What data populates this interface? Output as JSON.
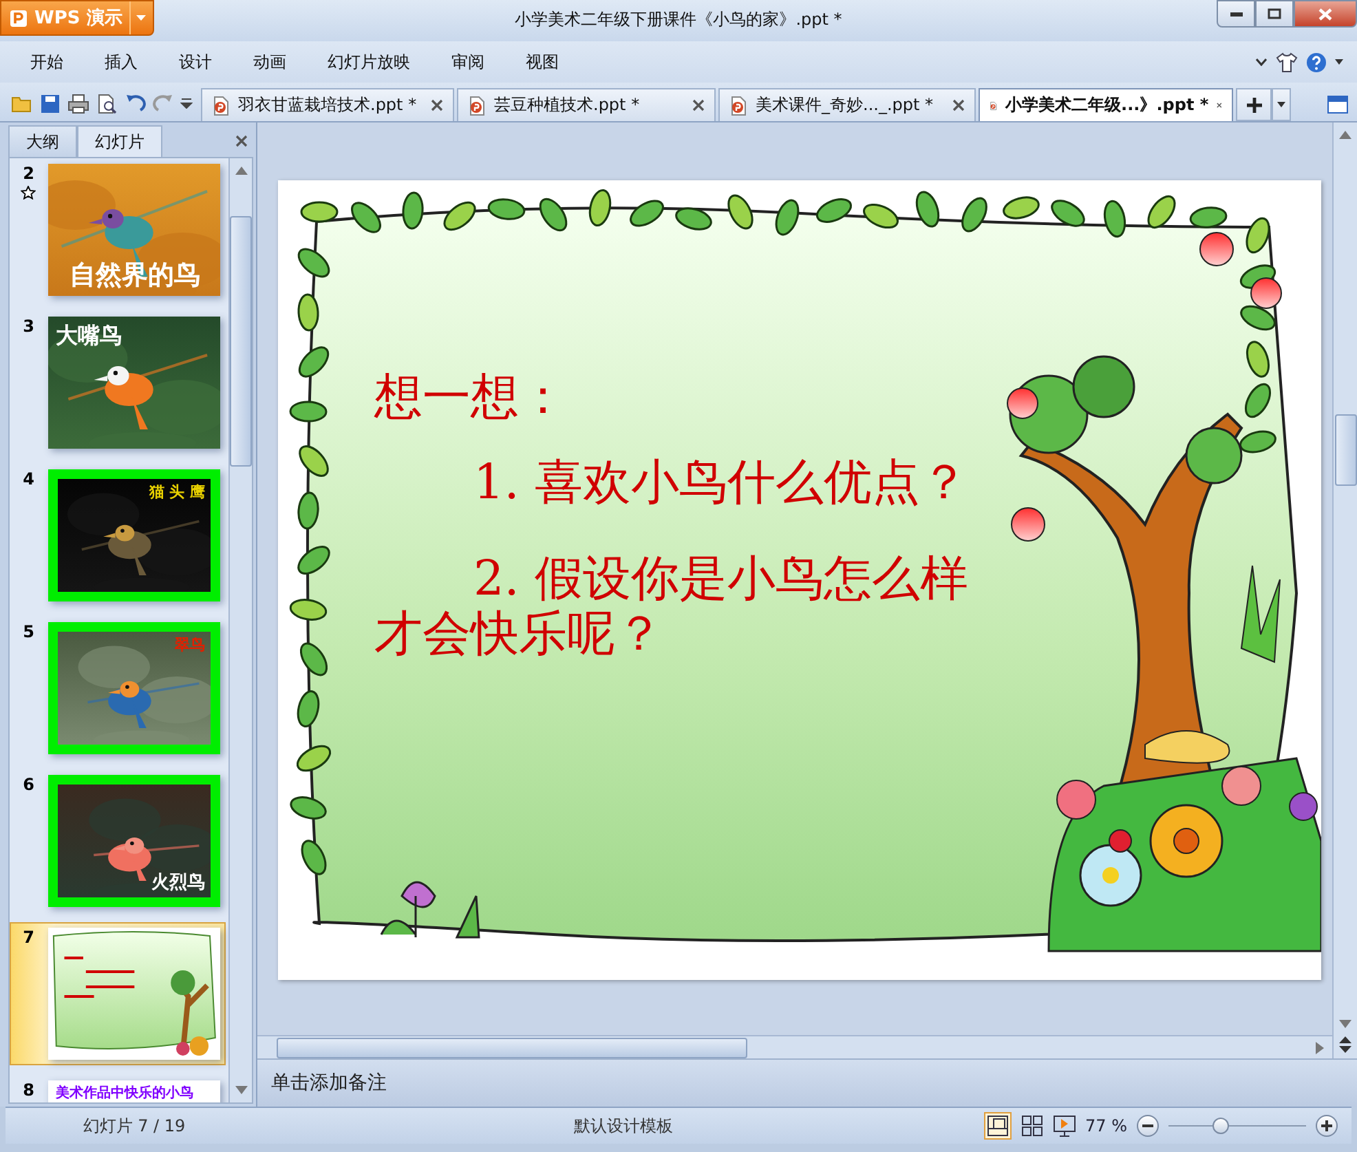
{
  "window": {
    "app_button": "WPS 演示",
    "title": "小学美术二年级下册课件《小鸟的家》.ppt *"
  },
  "menu": [
    "开始",
    "插入",
    "设计",
    "动画",
    "幻灯片放映",
    "审阅",
    "视图"
  ],
  "doc_tabs": [
    {
      "label": "羽衣甘蓝栽培技术.ppt *",
      "selected": false
    },
    {
      "label": "芸豆种植技术.ppt *",
      "selected": false
    },
    {
      "label": "美术课件_奇妙..._.ppt *",
      "selected": false
    },
    {
      "label": "小学美术二年级...》.ppt *",
      "selected": true
    }
  ],
  "pane_tabs": [
    {
      "label": "大纲",
      "selected": false
    },
    {
      "label": "幻灯片",
      "selected": true
    }
  ],
  "thumbnails": [
    {
      "number": "2",
      "title": "自然界的鸟",
      "color": "#ffffff",
      "framed": false,
      "animated": true,
      "selected": false
    },
    {
      "number": "3",
      "title": "大嘴鸟",
      "color": "#ffffff",
      "framed": false,
      "animated": false,
      "selected": false
    },
    {
      "number": "4",
      "title": "猫 头 鹰",
      "color": "#e8d000",
      "framed": true,
      "animated": false,
      "selected": false
    },
    {
      "number": "5",
      "title": "翠鸟",
      "color": "#e02000",
      "framed": true,
      "animated": false,
      "selected": false
    },
    {
      "number": "6",
      "title": "火烈鸟",
      "color": "#ffffff",
      "framed": true,
      "animated": false,
      "selected": false
    },
    {
      "number": "7",
      "kind": "preview",
      "animated": false,
      "selected": true
    },
    {
      "number": "8",
      "kind": "text",
      "title": "美术作品中快乐的小鸟",
      "color": "#8000ff",
      "framed": false,
      "animated": false,
      "selected": false
    }
  ],
  "slide": {
    "heading": "想一想：",
    "paragraphs": [
      "1. 喜欢小鸟什么优点？",
      "2. 假设你是小鸟怎么样才会快乐呢？"
    ]
  },
  "notes": {
    "placeholder": "单击添加备注"
  },
  "status_bar": {
    "slide_counter": "幻灯片 7 / 19",
    "template": "默认设计模板",
    "zoom": "77 %",
    "zoom_slider": {
      "level": 0.38
    }
  }
}
